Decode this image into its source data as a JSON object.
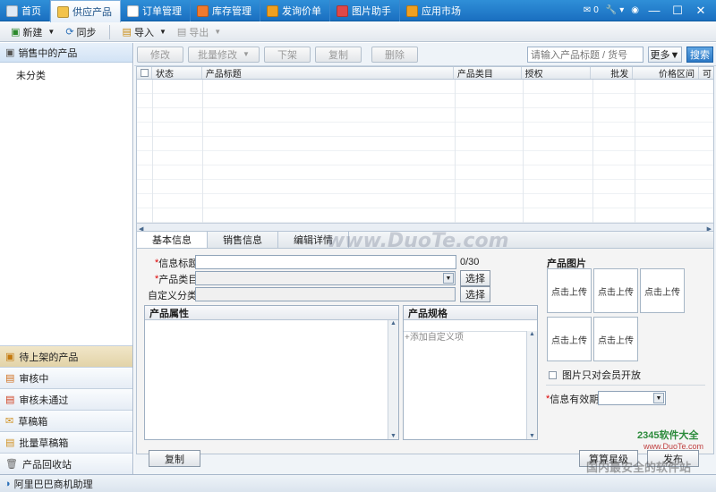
{
  "nav": {
    "tabs": [
      {
        "label": "首页",
        "icon": "home-icon",
        "color": "#dfe9f5"
      },
      {
        "label": "供应产品",
        "icon": "supply-icon",
        "color": "#f3c34a"
      },
      {
        "label": "订单管理",
        "icon": "order-icon",
        "color": "#ffffff"
      },
      {
        "label": "库存管理",
        "icon": "stock-icon",
        "color": "#f07a2e"
      },
      {
        "label": "发询价单",
        "icon": "inquiry-icon",
        "color": "#f0a020"
      },
      {
        "label": "图片助手",
        "icon": "image-icon",
        "color": "#e04848"
      },
      {
        "label": "应用市场",
        "icon": "market-icon",
        "color": "#f0a020"
      }
    ],
    "mail_count": "0"
  },
  "toolbar": {
    "new_label": "新建",
    "sync_label": "同步",
    "import_label": "导入",
    "export_label": "导出"
  },
  "sidebar": {
    "header": "销售中的产品",
    "sub_item": "未分类",
    "bottom_items": [
      {
        "label": "待上架的产品",
        "icon": "pending-icon"
      },
      {
        "label": "审核中",
        "icon": "reviewing-icon"
      },
      {
        "label": "审核未通过",
        "icon": "rejected-icon"
      },
      {
        "label": "草稿箱",
        "icon": "draft-icon"
      },
      {
        "label": "批量草稿箱",
        "icon": "batch-draft-icon"
      },
      {
        "label": "产品回收站",
        "icon": "trash-icon"
      }
    ]
  },
  "actions": {
    "modify": "修改",
    "batch_modify": "批量修改",
    "unlist": "下架",
    "copy": "复制",
    "delete": "删除",
    "search_placeholder": "请输入产品标题 / 货号",
    "more": "更多▼",
    "search": "搜索"
  },
  "grid": {
    "columns": [
      "状态",
      "产品标题",
      "产品类目",
      "授权",
      "批发",
      "价格区间",
      "可"
    ]
  },
  "detail": {
    "tabs": [
      "基本信息",
      "销售信息",
      "编辑详情"
    ],
    "info_title_label": "信息标题:",
    "char_count": "0/30",
    "category_label": "产品类目:",
    "custom_category_label": "自定义分类:",
    "select_label": "选择",
    "attributes_title": "产品属性",
    "specs_title": "产品规格",
    "add_custom_item": "+添加自定义项",
    "images_title": "产品图片",
    "upload_label": "点击上传",
    "members_only_label": "图片只对会员开放",
    "validity_label": "信息有效期:",
    "copy_button": "复制",
    "calc_star_button": "算算星级",
    "publish_button": "发布"
  },
  "status_bar": {
    "app_name": "阿里巴巴商机助理"
  },
  "watermarks": {
    "center": "www.DuoTe.com",
    "corner_brand": "2345软件大全",
    "corner_url": "www.DuoTe.com",
    "corner_slogan": "国内最安全的软件站"
  }
}
